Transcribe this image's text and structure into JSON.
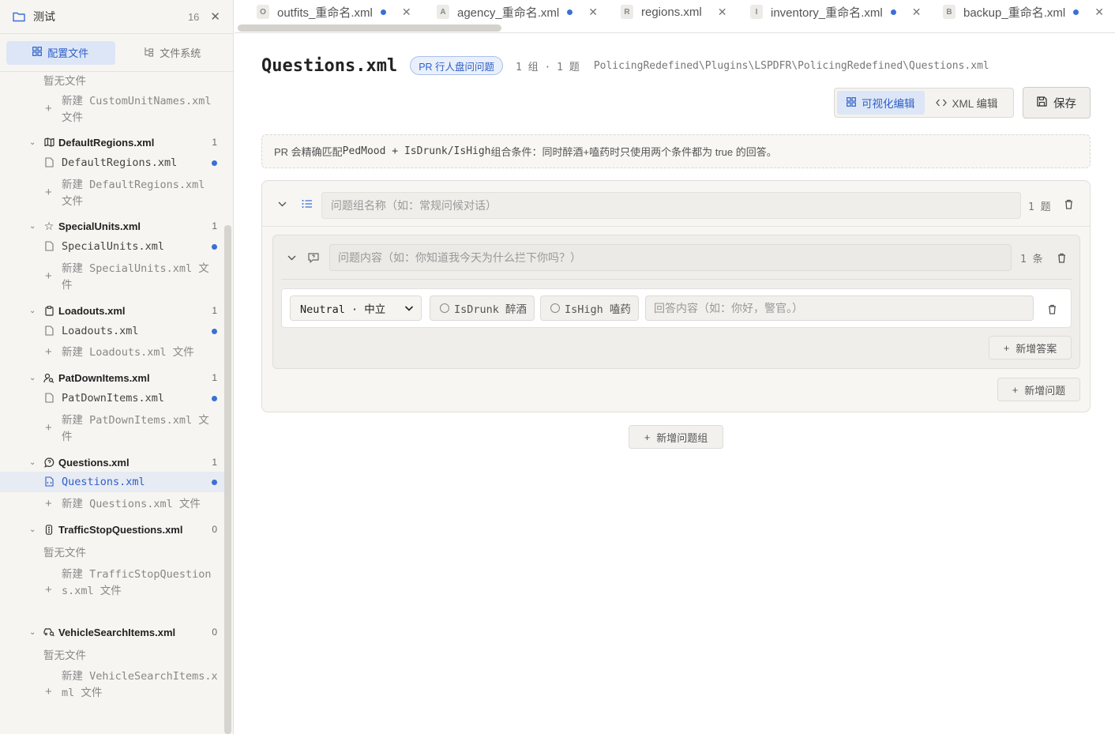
{
  "sidebar": {
    "workspace_name": "测试",
    "workspace_count": "16",
    "tabs": [
      {
        "label": "配置文件",
        "active": true
      },
      {
        "label": "文件系统",
        "active": false
      }
    ],
    "top_empty_text": "暂无文件",
    "top_new_file": "新建 CustomUnitNames.xml 文件",
    "groups": [
      {
        "name": "DefaultRegions.xml",
        "icon": "map-icon",
        "count": "1",
        "file": "DefaultRegions.xml",
        "new_file": "新建 DefaultRegions.xml 文件"
      },
      {
        "name": "SpecialUnits.xml",
        "icon": "star-icon",
        "count": "1",
        "file": "SpecialUnits.xml",
        "new_file": "新建 SpecialUnits.xml 文件"
      },
      {
        "name": "Loadouts.xml",
        "icon": "clipboard-icon",
        "count": "1",
        "file": "Loadouts.xml",
        "new_file": "新建 Loadouts.xml 文件"
      },
      {
        "name": "PatDownItems.xml",
        "icon": "user-search-icon",
        "count": "1",
        "file": "PatDownItems.xml",
        "new_file": "新建 PatDownItems.xml 文件"
      },
      {
        "name": "Questions.xml",
        "icon": "message-question-icon",
        "count": "1",
        "file": "Questions.xml",
        "new_file": "新建 Questions.xml 文件"
      },
      {
        "name": "TrafficStopQuestions.xml",
        "icon": "traffic-light-icon",
        "count": "0",
        "empty": "暂无文件",
        "new_file": "新建 TrafficStopQuestions.xml 文件"
      },
      {
        "name": "VehicleSearchItems.xml",
        "icon": "car-search-icon",
        "count": "0",
        "empty": "暂无文件",
        "new_file": "新建 VehicleSearchItems.xml 文件"
      }
    ]
  },
  "tabs": [
    {
      "badge": "O",
      "label": "outfits_重命名.xml",
      "modified": true
    },
    {
      "badge": "A",
      "label": "agency_重命名.xml",
      "modified": true
    },
    {
      "badge": "R",
      "label": "regions.xml",
      "modified": false
    },
    {
      "badge": "I",
      "label": "inventory_重命名.xml",
      "modified": true
    },
    {
      "badge": "B",
      "label": "backup_重命名.xml",
      "modified": true
    }
  ],
  "editor": {
    "title": "Questions.xml",
    "type_pill": "PR 行人盘问问题",
    "stats": "1 组 · 1 题",
    "path": "PolicingRedefined\\Plugins\\LSPDFR\\PolicingRedefined\\Questions.xml",
    "view_toggle": {
      "visual": "可视化编辑",
      "xml": "XML 编辑"
    },
    "save_label": "保存",
    "notice": {
      "prefix": "PR 会精确匹配 ",
      "code": "PedMood + IsDrunk/IsHigh",
      "suffix": " 组合条件：同时醉酒+嗑药时只使用两个条件都为 true 的回答。"
    },
    "group": {
      "name_placeholder": "问题组名称（如：常规问候对话）",
      "count": "1 题",
      "question": {
        "placeholder": "问题内容（如：你知道我今天为什么拦下你吗？）",
        "count": "1 条",
        "answer": {
          "mood": "Neutral · 中立",
          "drunk_label": "IsDrunk 醉酒",
          "high_label": "IsHigh 嗑药",
          "placeholder": "回答内容（如：你好，警官。）"
        },
        "add_answer": "新增答案"
      },
      "add_question": "新增问题"
    },
    "add_group": "新增问题组"
  },
  "colors": {
    "accent": "#3b6fd8",
    "sidebar_bg": "#f6f5f2"
  }
}
